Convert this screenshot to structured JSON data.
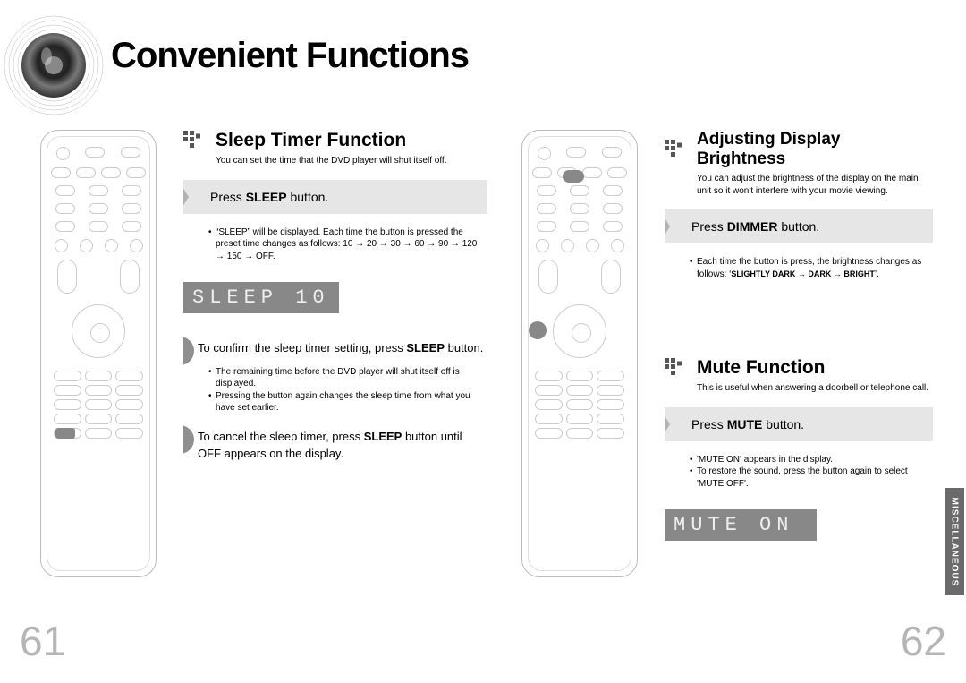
{
  "title": "Convenient Functions",
  "left": {
    "section_title": "Sleep Timer Function",
    "section_subtitle": "You can set the time that the DVD player will shut itself off.",
    "action_pre": "Press ",
    "action_bold": "SLEEP",
    "action_post": " button.",
    "bullet1": "“SLEEP” will be displayed. Each time the button is pressed the preset time changes as follows: 10 → 20 → 30 → 60 → 90 → 120 → 150 → OFF.",
    "display": "SLEEP  10",
    "step1_pre": "To confirm the sleep timer setting, press ",
    "step1_bold": "SLEEP",
    "step1_post": " button.",
    "step1_bullet1": "The remaining time before the DVD player will shut itself off is displayed.",
    "step1_bullet2": "Pressing the button again changes the sleep time from what you have set earlier.",
    "step2_pre": "To cancel the sleep timer, press ",
    "step2_bold": "SLEEP",
    "step2_post": " button until OFF appears on the display."
  },
  "right_a": {
    "section_title": "Adjusting Display Brightness",
    "section_subtitle": "You can adjust the brightness of the display on the main unit so it won't interfere with your movie viewing.",
    "action_pre": "Press ",
    "action_bold": "DIMMER",
    "action_post": " button.",
    "bullet_pre": "Each time the button is press, the brightness changes as follows: ‘",
    "seq": "SLIGHTLY DARK → DARK → BRIGHT",
    "bullet_post": "’."
  },
  "right_b": {
    "section_title": "Mute Function",
    "section_subtitle": "This is useful when answering a doorbell or telephone call.",
    "action_pre": "Press ",
    "action_bold": "MUTE",
    "action_post": " button.",
    "bullet1": "'MUTE ON' appears in the display.",
    "bullet2": "To restore the sound, press the button again to select 'MUTE OFF'.",
    "display": "MUTE ON"
  },
  "page_left": "61",
  "page_right": "62",
  "side_tab": "MISCELLANEOUS"
}
